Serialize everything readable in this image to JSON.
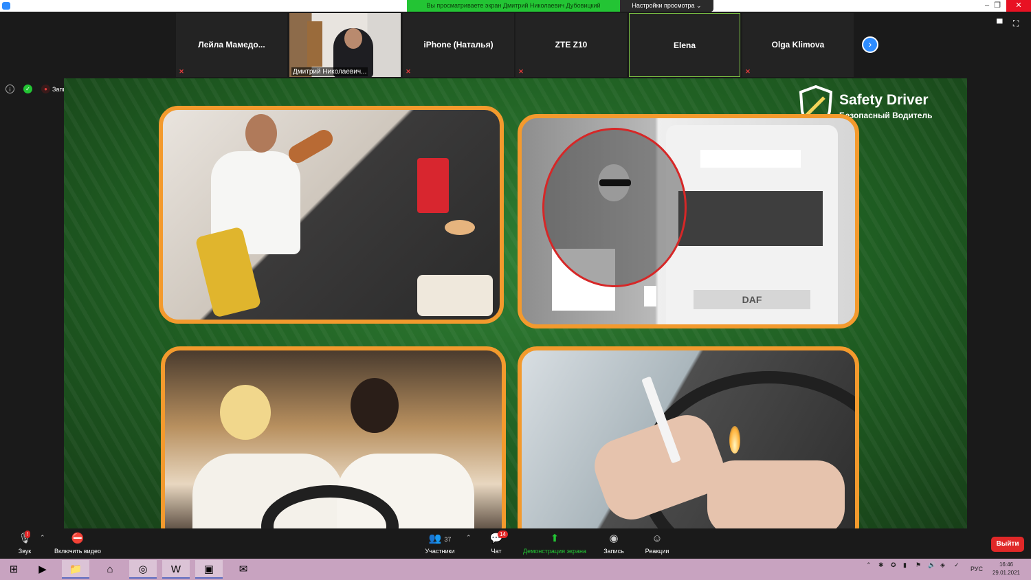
{
  "titlebar": {
    "share_banner": "Вы просматриваете экран Дмитрий Николаевич Дубовицкий",
    "view_options": "Настройки просмотра ⌄",
    "controls": {
      "minimize": "–",
      "restore": "❐",
      "close": "✕"
    }
  },
  "participants": [
    {
      "name": "Лейла  Мамедо...",
      "muted": true,
      "video": false,
      "active": false
    },
    {
      "name": "Дмитрий Николаевич...",
      "muted": false,
      "video": true,
      "active": false
    },
    {
      "name": "iPhone (Наталья)",
      "muted": true,
      "video": false,
      "active": false
    },
    {
      "name": "ZTE Z10",
      "muted": true,
      "video": false,
      "active": false
    },
    {
      "name": "Elena",
      "muted": false,
      "video": false,
      "active": true
    },
    {
      "name": "Olga Klimova",
      "muted": true,
      "video": false,
      "active": false
    }
  ],
  "strip_next": "›",
  "layout_icons": {
    "view": "▀",
    "fullscreen": "⛶"
  },
  "status": {
    "info_icon": "i",
    "shield_icon": "✓",
    "rec_icon": "●",
    "recording_label": "Запись"
  },
  "slide": {
    "brand_title": "Safety Driver",
    "brand_subtitle": "Безопасный Водитель",
    "truck_label": "DAF",
    "colors": {
      "frame": "#f39a2d",
      "background": "#1f5e22",
      "mark": "#d62727"
    }
  },
  "toolbar": {
    "audio_label": "Звук",
    "audio_badge": "!",
    "video_label": "Включить видео",
    "participants_label": "Участники",
    "participants_count": "37",
    "chat_label": "Чат",
    "chat_badge": "14",
    "share_label": "Демонстрация экрана",
    "record_label": "Запись",
    "reactions_label": "Реакции",
    "leave_label": "Выйти",
    "caret": "⌃"
  },
  "taskbar": {
    "language": "РУС",
    "time": "16:46",
    "date": "29.01.2021"
  }
}
